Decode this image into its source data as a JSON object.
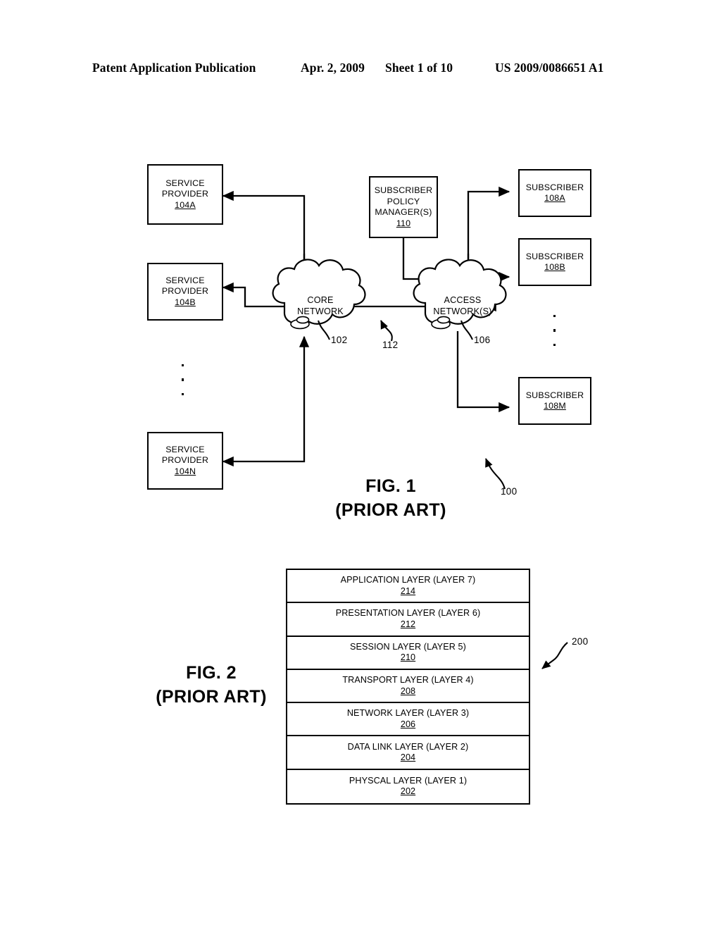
{
  "header": {
    "publication": "Patent Application Publication",
    "date": "Apr. 2, 2009",
    "sheet": "Sheet 1 of 10",
    "doc_number": "US 2009/0086651 A1"
  },
  "figure1": {
    "caption_line1": "FIG. 1",
    "caption_line2": "(PRIOR ART)",
    "diagram_ref": "100",
    "service_providers": [
      {
        "line1": "SERVICE",
        "line2": "PROVIDER",
        "ref": "104A"
      },
      {
        "line1": "SERVICE",
        "line2": "PROVIDER",
        "ref": "104B"
      },
      {
        "line1": "SERVICE",
        "line2": "PROVIDER",
        "ref": "104N"
      }
    ],
    "policy_manager": {
      "line1": "SUBSCRIBER",
      "line2": "POLICY",
      "line3": "MANAGER(S)",
      "ref": "110"
    },
    "subscribers": [
      {
        "label": "SUBSCRIBER",
        "ref": "108A"
      },
      {
        "label": "SUBSCRIBER",
        "ref": "108B"
      },
      {
        "label": "SUBSCRIBER",
        "ref": "108M"
      }
    ],
    "clouds": [
      {
        "line1": "CORE",
        "line2": "NETWORK",
        "ref": "102"
      },
      {
        "line1": "ACCESS",
        "line2": "NETWORK(S)",
        "ref": "106"
      }
    ],
    "link_ref": "112"
  },
  "figure2": {
    "caption_line1": "FIG. 2",
    "caption_line2": "(PRIOR ART)",
    "diagram_ref": "200",
    "layers": [
      {
        "name": "APPLICATION LAYER (LAYER 7)",
        "ref": "214"
      },
      {
        "name": "PRESENTATION LAYER (LAYER 6)",
        "ref": "212"
      },
      {
        "name": "SESSION LAYER (LAYER 5)",
        "ref": "210"
      },
      {
        "name": "TRANSPORT LAYER (LAYER 4)",
        "ref": "208"
      },
      {
        "name": "NETWORK LAYER (LAYER 3)",
        "ref": "206"
      },
      {
        "name": "DATA LINK LAYER (LAYER 2)",
        "ref": "204"
      },
      {
        "name": "PHYSCAL LAYER (LAYER 1)",
        "ref": "202"
      }
    ]
  }
}
